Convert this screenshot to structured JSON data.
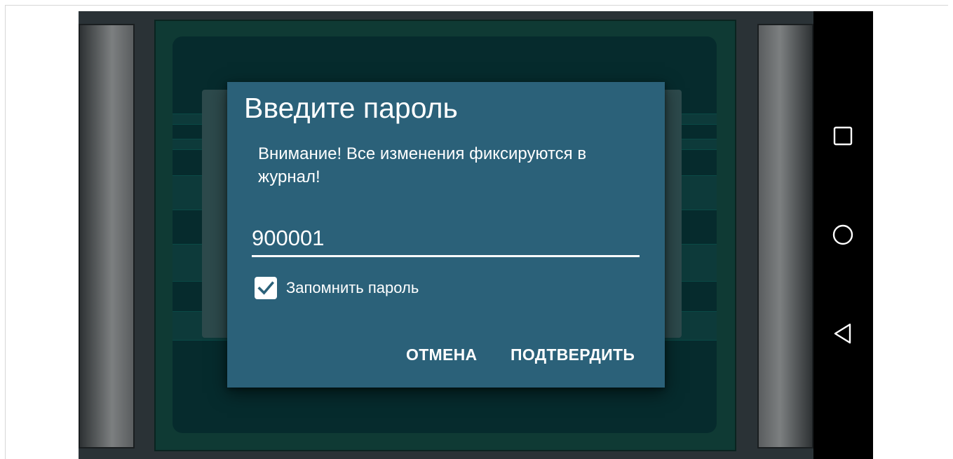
{
  "dialog": {
    "title": "Введите пароль",
    "message": "Внимание! Все изменения фиксируются в журнал!",
    "password_value": "900001",
    "remember_checked": true,
    "remember_label": "Запомнить пароль",
    "cancel_label": "ОТМЕНА",
    "confirm_label": "ПОДТВЕРДИТЬ"
  },
  "nav_bar": {
    "buttons": [
      "recent-apps-icon",
      "home-icon",
      "back-icon"
    ]
  },
  "colors": {
    "dialog_background": "#2b6179",
    "app_background": "#062b2d",
    "nav_bar": "#000000",
    "text": "#ffffff"
  }
}
